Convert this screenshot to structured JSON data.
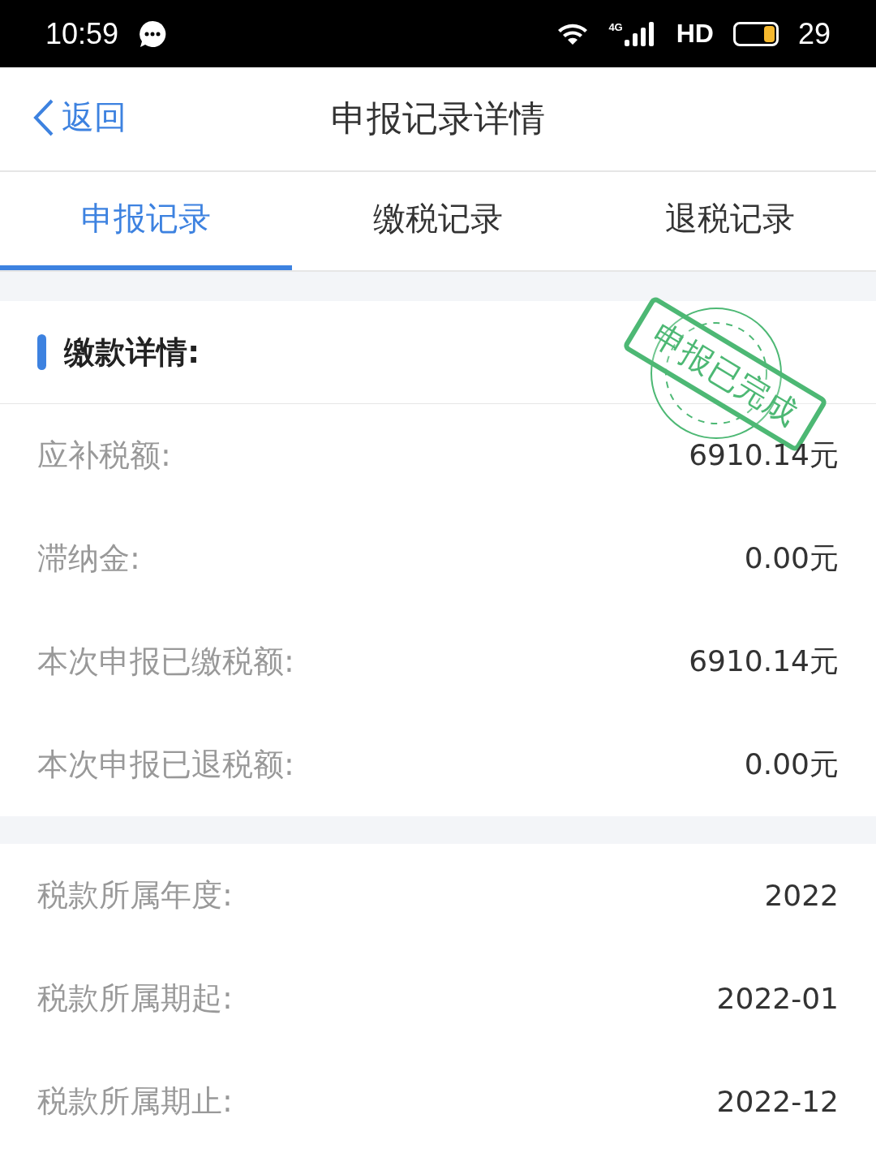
{
  "status_bar": {
    "time": "10:59",
    "network": "4G",
    "hd": "HD",
    "battery": "29"
  },
  "nav": {
    "back": "返回",
    "title": "申报记录详情"
  },
  "tabs": [
    {
      "label": "申报记录",
      "selected": true
    },
    {
      "label": "缴税记录",
      "selected": false
    },
    {
      "label": "退税记录",
      "selected": false
    }
  ],
  "payment": {
    "heading": "缴款详情:",
    "stamp": "申报已完成",
    "rows": [
      {
        "label": "应补税额:",
        "value": "6910.14元"
      },
      {
        "label": "滞纳金:",
        "value": "0.00元"
      },
      {
        "label": "本次申报已缴税额:",
        "value": "6910.14元"
      },
      {
        "label": "本次申报已退税额:",
        "value": "0.00元"
      }
    ]
  },
  "period": {
    "rows": [
      {
        "label": "税款所属年度:",
        "value": "2022"
      },
      {
        "label": "税款所属期起:",
        "value": "2022-01"
      },
      {
        "label": "税款所属期止:",
        "value": "2022-12"
      }
    ]
  }
}
